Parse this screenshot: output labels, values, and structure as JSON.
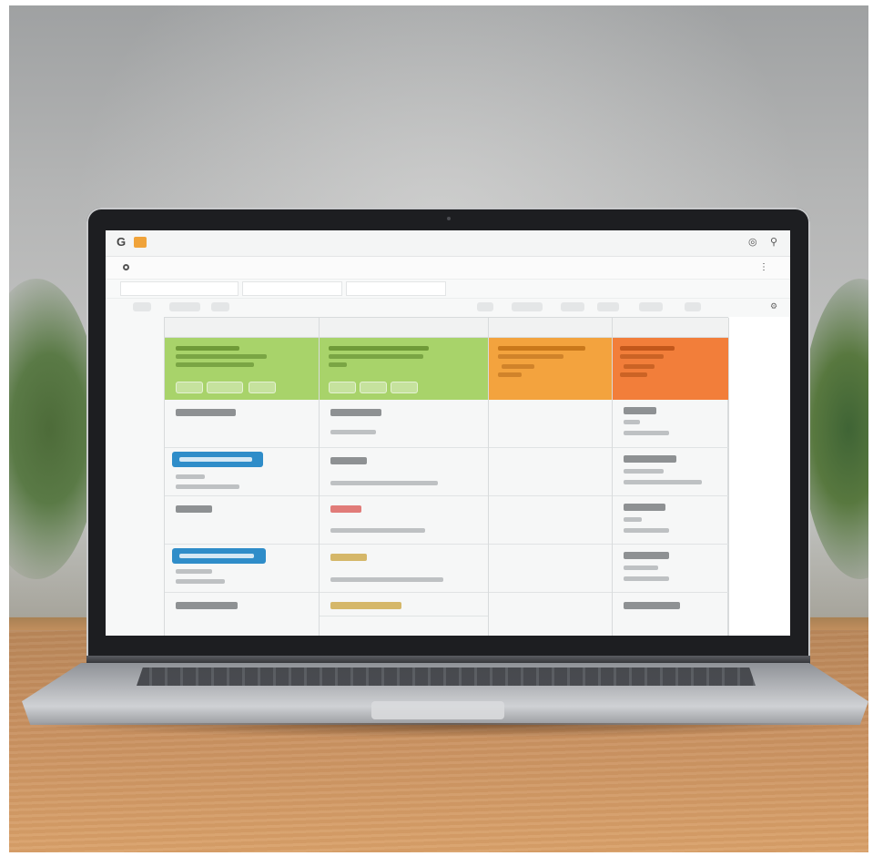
{
  "colors": {
    "green_column": "#a8d36a",
    "orange_column": "#f3a33e",
    "deep_orange_column": "#f27e3a",
    "accent_button": "#2f8dc9",
    "red_text": "#d9534f",
    "gold_text": "#c9a23a"
  },
  "app": {
    "logo_icon": "g-logo-icon",
    "title": ""
  },
  "menubar": {
    "items": [
      {
        "label": ""
      },
      {
        "label": ""
      }
    ]
  },
  "tabs": [
    {
      "label": ""
    },
    {
      "label": ""
    },
    {
      "label": ""
    }
  ],
  "board": {
    "columns": [
      {
        "header": ""
      },
      {
        "header": ""
      },
      {
        "header": ""
      },
      {
        "header": ""
      }
    ]
  }
}
